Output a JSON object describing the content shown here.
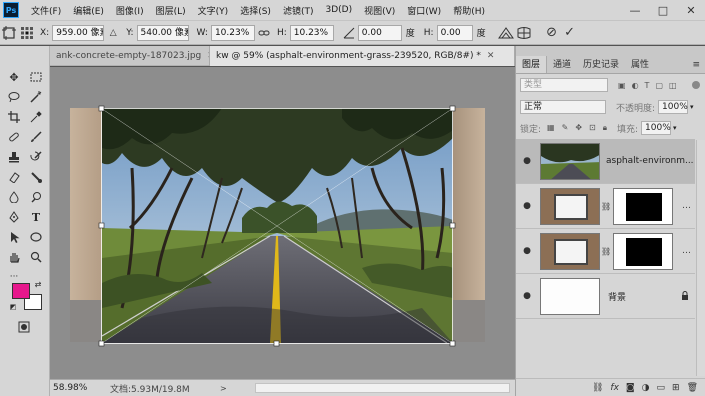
{
  "menu": {
    "logo": "Ps",
    "items": [
      "文件(F)",
      "编辑(E)",
      "图像(I)",
      "图层(L)",
      "文字(Y)",
      "选择(S)",
      "滤镜(T)",
      "3D(D)",
      "视图(V)",
      "窗口(W)",
      "帮助(H)"
    ],
    "window_controls": [
      "—",
      "□",
      "✕"
    ]
  },
  "options": {
    "x_label": "X:",
    "x_value": "959.00 像素",
    "y_label": "Y:",
    "y_value": "540.00 像素",
    "w_label": "W:",
    "w_value": "10.23%",
    "h_label": "H:",
    "h_value": "10.23%",
    "angle_value": "0.00",
    "angle_unit": "度",
    "h_skew_label": "H:",
    "h_skew_value": "0.00",
    "h_skew_unit": "度"
  },
  "tabs": [
    {
      "label": "ank-concrete-empty-187023.jpg",
      "active": false
    },
    {
      "label": "kw @ 59% (asphalt-environment-grass-239520, RGB/8#) *",
      "active": true
    }
  ],
  "tools": {
    "foreground_color": "#e6178c",
    "background_color": "#ffffff"
  },
  "status": {
    "zoom": "58.98%",
    "doc_info": "文档:5.93M/19.8M",
    "arrow": ">"
  },
  "panel": {
    "tabs": [
      "图层",
      "通道",
      "历史记录",
      "属性"
    ],
    "search_placeholder": "类型",
    "blend_mode": "正常",
    "opacity_label": "不透明度:",
    "opacity_value": "100%",
    "lock_label": "锁定:",
    "fill_label": "填充:",
    "fill_value": "100%",
    "layers": [
      {
        "name": "asphalt-environm...",
        "type": "photo",
        "selected": true
      },
      {
        "name": "",
        "type": "masked",
        "selected": false
      },
      {
        "name": "",
        "type": "masked",
        "selected": false
      },
      {
        "name": "背景",
        "type": "background",
        "selected": false
      }
    ],
    "bottom_icons": [
      "link-icon",
      "fx-icon",
      "mask-icon",
      "adjustment-icon",
      "group-icon",
      "new-layer-icon",
      "trash-icon"
    ]
  }
}
